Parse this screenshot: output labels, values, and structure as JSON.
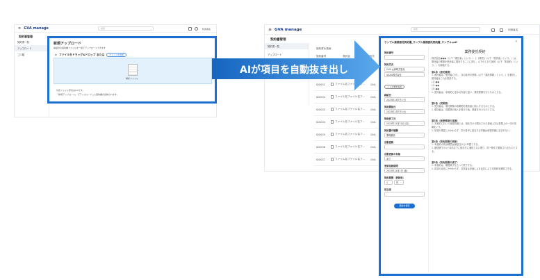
{
  "left_app": {
    "logo": "GVA manage",
    "search_placeholder": "検索",
    "user": "利用者名",
    "page_title": "契約書管理",
    "sidebar": [
      "契約書一覧",
      "アップロード",
      "ゴミ箱"
    ],
    "card_title": "新規アップロード",
    "card_desc": "締結済の契約書ファイルを一括でアップロードできます",
    "drop_label": "ファイルをドラッグ&ドロップ または",
    "select_button": "ファイルを選択",
    "file_label": "解析ファイル",
    "notes": [
      "対応ファイル形式はpdfです。",
      "「新規アップロード」でアップロードした契約書が反映されます。"
    ]
  },
  "banner": {
    "text": "AIが項目を自動抜き出し",
    "color": "#1a6fd0"
  },
  "right_app": {
    "logo": "GVA manage",
    "search_placeholder": "検索",
    "user": "利用者名",
    "page_title": "契約書管理",
    "sidebar": [
      "契約書一覧",
      "アップロード"
    ],
    "table_search": "契約書を検索",
    "columns": [
      "契約番号",
      "契約名",
      "契約先"
    ],
    "rows": [
      {
        "id": "ID0001",
        "name": "ファイル名ファイル名フ…",
        "party": "GVA"
      },
      {
        "id": "ID0002",
        "name": "ファイル名ファイル名フ…",
        "party": "GVA"
      },
      {
        "id": "ID0003",
        "name": "ファイル名ファイル名フ…",
        "party": "GVA"
      },
      {
        "id": "ID0004",
        "name": "ファイル名ファイル名フ…",
        "party": "GVA"
      },
      {
        "id": "ID0005",
        "name": "ファイル名ファイル名フ…",
        "party": "GVA"
      },
      {
        "id": "ID0006",
        "name": "ファイル名ファイル名フ…",
        "party": "GVA"
      },
      {
        "id": "ID0007",
        "name": "ファイル名ファイル名フ…",
        "party": "GVA"
      }
    ]
  },
  "modal": {
    "title": "サンプル業務委託契約書_サンプル業務委託契約書_サンプル.pdf",
    "fields": [
      {
        "label": "契約番号",
        "value": ""
      },
      {
        "label": "契約先名",
        "value": "GVA 太郎株式会社"
      },
      {
        "label": "",
        "value": "AAAA株式会社"
      },
      {
        "label": "締結日",
        "value": "2023年1月7日 (土)"
      },
      {
        "label": "契約開始日",
        "value": "2023年1月7日 (土)"
      },
      {
        "label": "契約終了日",
        "value": "2023年12月31日 (日)"
      },
      {
        "label": "契約書の種類",
        "value": "業務委託"
      },
      {
        "label": "自動更新",
        "value": ""
      },
      {
        "label": "自動更新の有無",
        "value": "あり"
      },
      {
        "label": "更新拒絶期限",
        "value": "2023年12月1日 (金)"
      }
    ],
    "add_field": "+ 入力欄を追加",
    "period_label": "契約期間（更新後）",
    "period_value": "1",
    "period_unit": "年",
    "owner_label": "担当者",
    "save_button": "更新を保存",
    "doc_title": "業務委託契約",
    "doc_intro": "株式会社●●●（以下「委託者」という。）と【株式】（以下「受託者」という。）は、委託者の業務を受託者に委託することに関し、以下のとおり契約（以下「本契約」という。）を締結する。",
    "articles": [
      {
        "h": "第1条（委託業務）",
        "p": [
          "1. 委託者は、受託者に対し、次の各号の業務（以下「委託業務」という。）を委託し、受託者はこれを受託する。",
          "(1) ●●",
          "(2) ●●",
          "(3) ●●",
          "2. 受託者は、本契約に定める内容に従い、委託業務を行うものとする。"
        ]
      },
      {
        "h": "第2条（成果物）",
        "p": [
          "1. 受託者は、委託業務の成果物を委託者に納入するものとする。",
          "2. 委託者は、成果物の納入を受けた後、検査を行うものとする。"
        ]
      },
      {
        "h": "第3条（秘密情報の定義）",
        "p": [
          "1. 本契約において秘密情報とは、相手方から開示された技術上又は営業上の一切の情報をいう。",
          "2. 前項の規定にかかわらず、次の各号に該当する情報は秘密情報に含まれない。"
        ]
      },
      {
        "h": "第4条（契約期間の更新）",
        "p": [
          "1. 本契約の有効期間は締結日から1年間とする。",
          "2. 期間満了の1ヶ月前までに相手方に通知しない限り、同一条件で更新されるものとする。"
        ]
      },
      {
        "h": "第5条（契約期間の満了）",
        "p": [
          "1. 本契約は、期間満了をもって終了する。",
          "2. 前項の定めにかかわらず、当事者は書面による合意により本契約を解除できる。"
        ]
      }
    ]
  }
}
